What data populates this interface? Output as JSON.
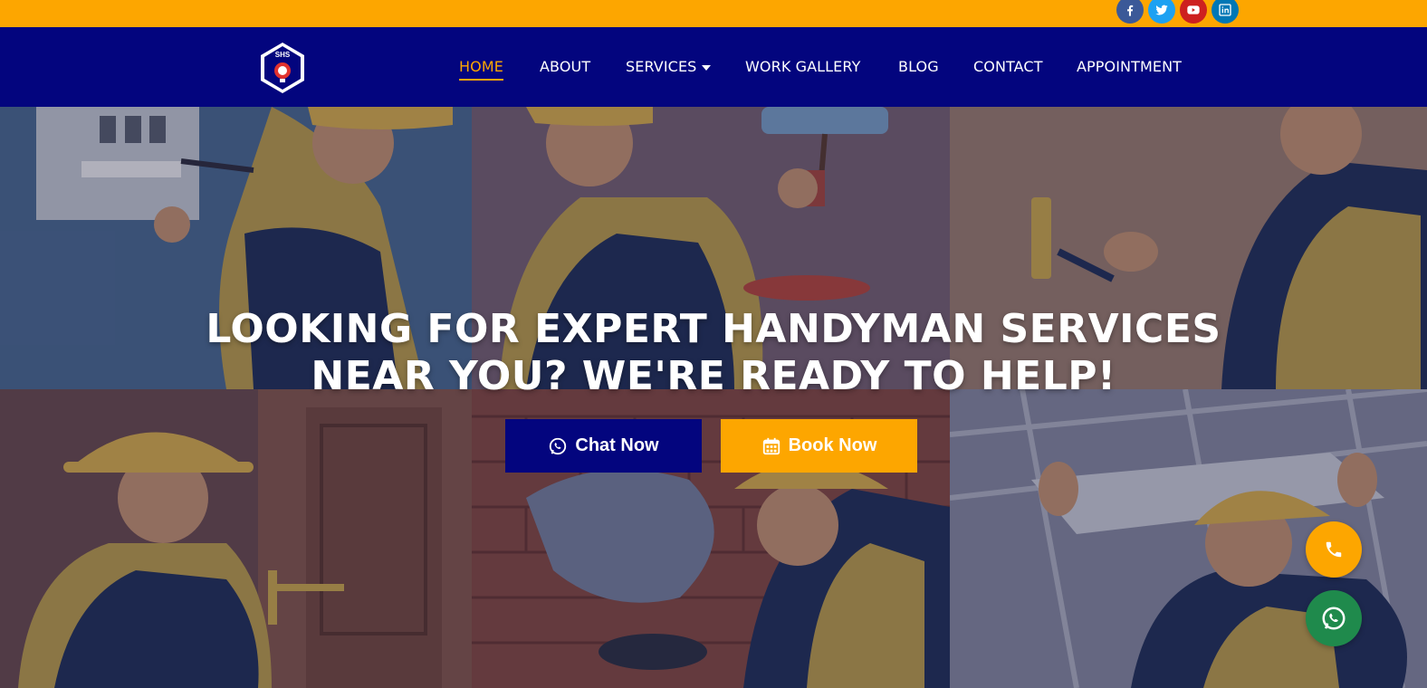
{
  "colors": {
    "accent": "#fda600",
    "navy": "#03057e",
    "white": "#ffffff",
    "facebook": "#3b5998",
    "twitter": "#1da1f2",
    "youtube": "#cd201f",
    "linkedin": "#0077b5",
    "whatsapp": "#1f8a4c"
  },
  "topbar": {
    "social": [
      {
        "name": "facebook-icon"
      },
      {
        "name": "twitter-icon"
      },
      {
        "name": "youtube-icon"
      },
      {
        "name": "linkedin-icon"
      }
    ]
  },
  "header": {
    "logo_text": "SHS",
    "nav": [
      {
        "label": "HOME",
        "active": true
      },
      {
        "label": "ABOUT"
      },
      {
        "label": "SERVICES",
        "has_dropdown": true
      },
      {
        "label": "WORK GALLERY"
      },
      {
        "label": "BLOG"
      },
      {
        "label": "CONTACT"
      },
      {
        "label": "APPOINTMENT"
      }
    ]
  },
  "hero": {
    "headline_line1": "LOOKING FOR EXPERT HANDYMAN SERVICES",
    "headline_line2": "NEAR YOU? WE'RE READY TO HELP!",
    "chat_button": "Chat Now",
    "book_button": "Book Now",
    "chat_icon": "whatsapp-icon",
    "book_icon": "calendar-icon"
  },
  "floating": {
    "phone_icon": "phone-icon",
    "whatsapp_icon": "whatsapp-icon"
  }
}
